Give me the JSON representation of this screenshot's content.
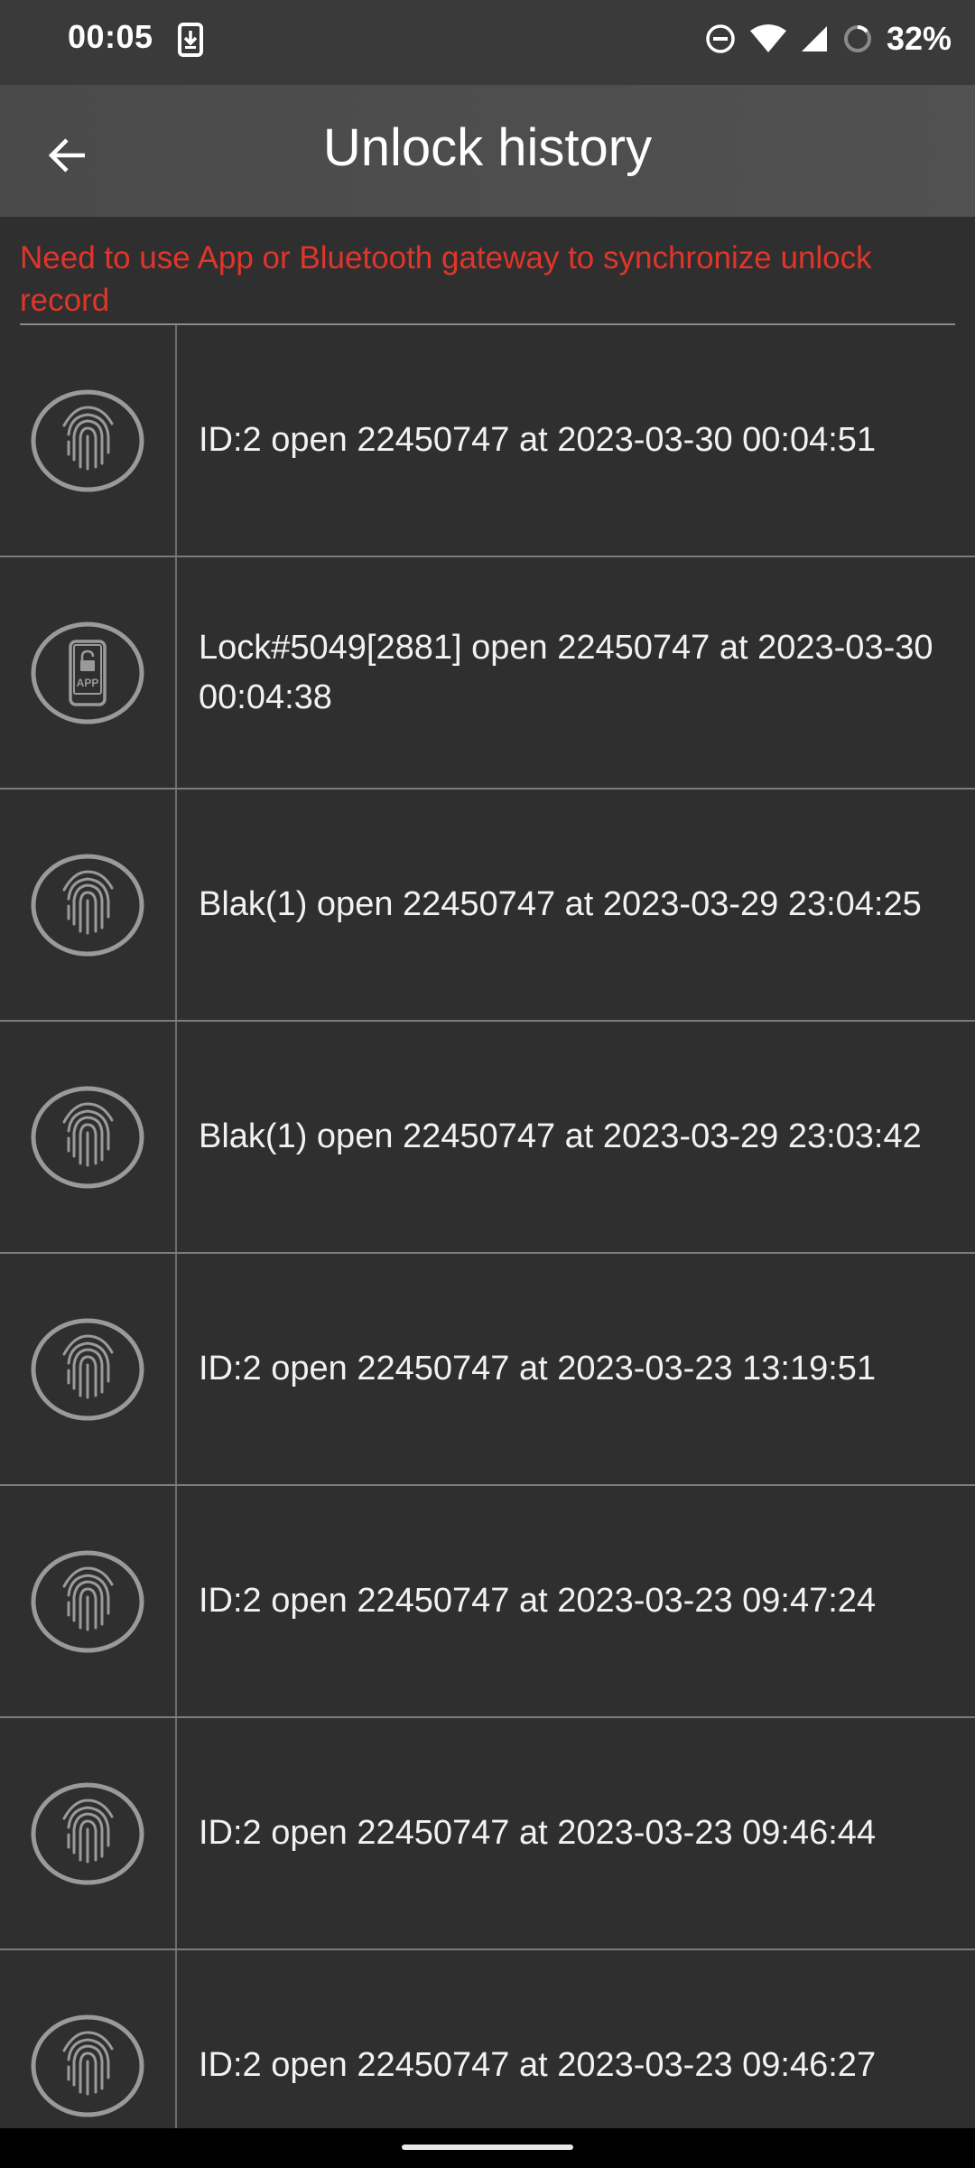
{
  "status_bar": {
    "time": "00:05",
    "battery": "32%",
    "icons": [
      "download-icon",
      "dnd-icon",
      "wifi-icon",
      "signal-icon",
      "battery-saver-icon"
    ]
  },
  "header": {
    "title": "Unlock history",
    "back_icon": "arrow-back-icon"
  },
  "notice": "Need to use App or Bluetooth gateway to synchronize unlock record",
  "records": [
    {
      "icon": "fingerprint-icon",
      "text": "ID:2  open 22450747 at 2023-03-30 00:04:51"
    },
    {
      "icon": "app-lock-icon",
      "text": "Lock#5049[2881] open 22450747 at 2023-03-30 00:04:38"
    },
    {
      "icon": "fingerprint-icon",
      "text": "Blak(1)  open 22450747 at 2023-03-29 23:04:25"
    },
    {
      "icon": "fingerprint-icon",
      "text": "Blak(1)  open 22450747 at 2023-03-29 23:03:42"
    },
    {
      "icon": "fingerprint-icon",
      "text": "ID:2  open 22450747 at 2023-03-23 13:19:51"
    },
    {
      "icon": "fingerprint-icon",
      "text": "ID:2  open 22450747 at 2023-03-23 09:47:24"
    },
    {
      "icon": "fingerprint-icon",
      "text": "ID:2  open 22450747 at 2023-03-23 09:46:44"
    },
    {
      "icon": "fingerprint-icon",
      "text": "ID:2  open 22450747 at 2023-03-23 09:46:27"
    }
  ],
  "colors": {
    "notice": "#e0352b",
    "background": "#2f2f2f",
    "appbar": "#4a4a4a",
    "icon_stroke": "#9a9a9a"
  }
}
